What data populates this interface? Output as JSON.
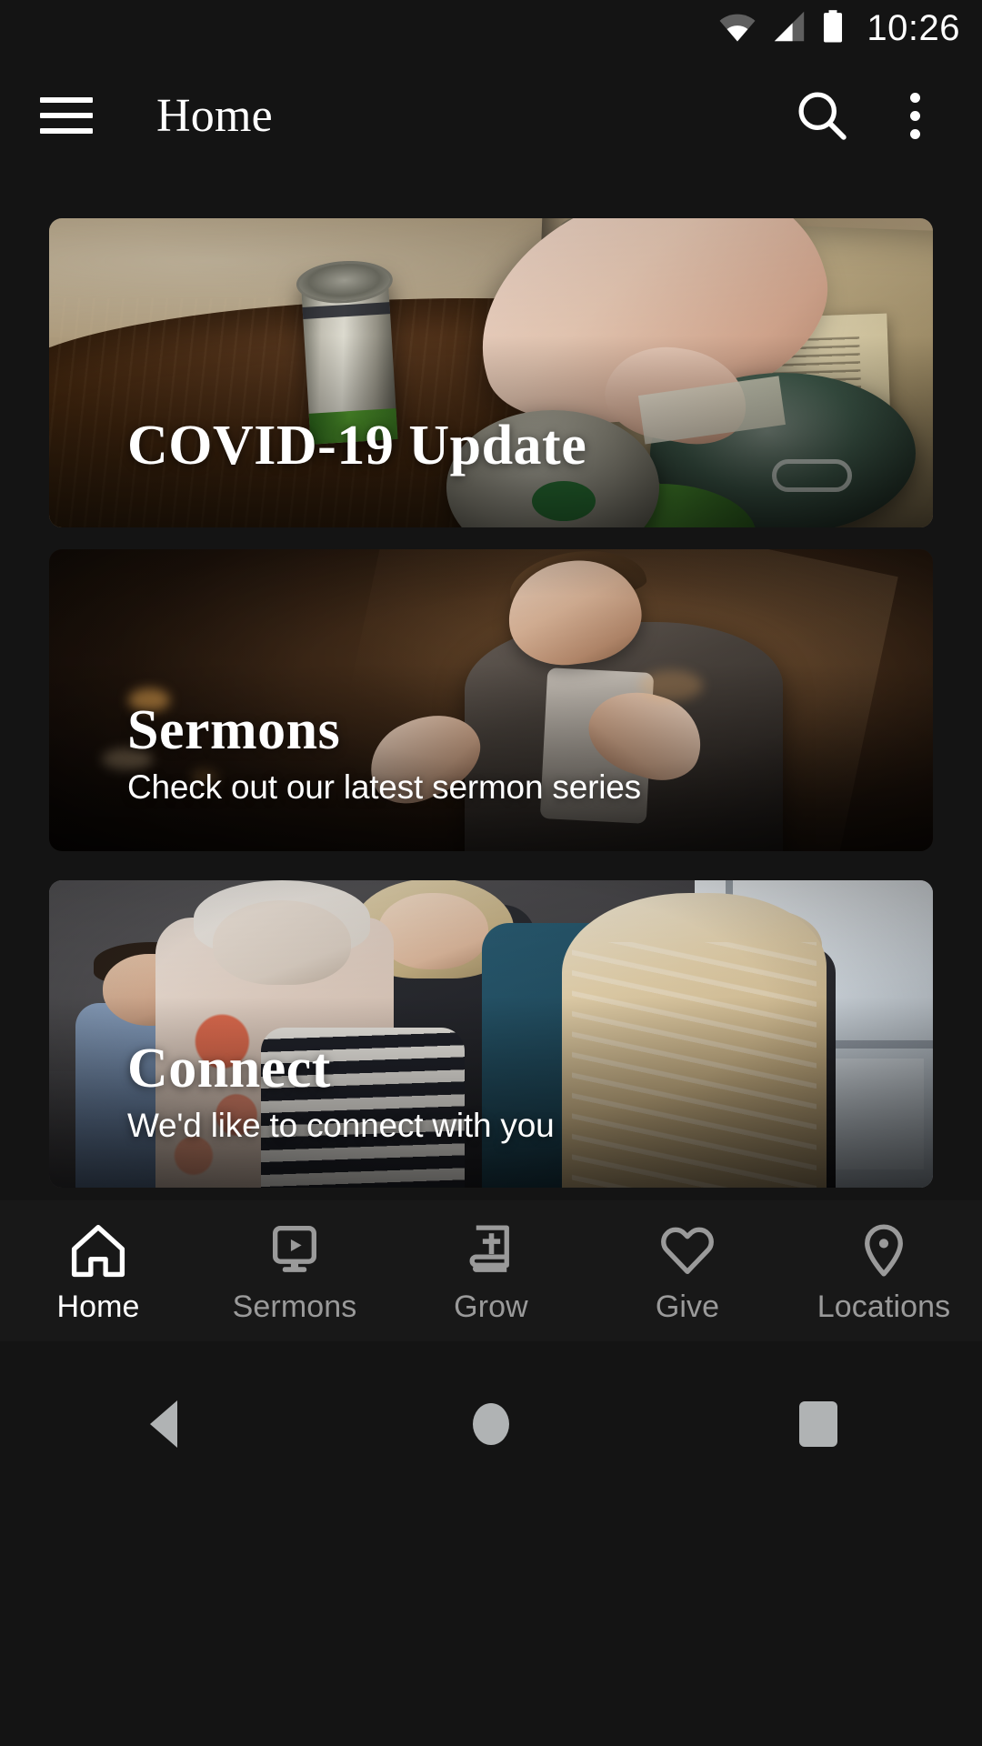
{
  "statusbar": {
    "time": "10:26",
    "wifi_icon": "wifi-icon",
    "signal_icon": "cell-signal-icon",
    "battery_icon": "battery-full-icon"
  },
  "appbar": {
    "menu_icon": "hamburger-menu-icon",
    "title": "Home",
    "search_icon": "search-icon",
    "overflow_icon": "more-vertical-icon"
  },
  "cards": [
    {
      "title": "COVID-19 Update",
      "subtitle": "",
      "image_alt": "hand placing canned food into a paper grocery bag on a dark wood table"
    },
    {
      "title": "Sermons",
      "subtitle": "Check out our latest sermon series",
      "image_alt": "man speaking on a dark stage with hands outstretched"
    },
    {
      "title": "Connect",
      "subtitle": "We'd like to connect with you",
      "image_alt": "group of people talking and smiling in a bright room"
    }
  ],
  "tabbar": {
    "items": [
      {
        "label": "Home",
        "icon": "home-icon",
        "active": true
      },
      {
        "label": "Sermons",
        "icon": "video-player-icon",
        "active": false
      },
      {
        "label": "Grow",
        "icon": "bible-cross-icon",
        "active": false
      },
      {
        "label": "Give",
        "icon": "heart-icon",
        "active": false
      },
      {
        "label": "Locations",
        "icon": "map-pin-icon",
        "active": false
      }
    ]
  },
  "sysnav": {
    "back_icon": "triangle-back-icon",
    "home_icon": "circle-home-icon",
    "recents_icon": "square-recents-icon"
  },
  "colors": {
    "background": "#141414",
    "tabbar_background": "#181818",
    "active_text": "#ffffff",
    "inactive_text": "#9a9a9a",
    "sysnav_icon": "#b0b3b4"
  }
}
